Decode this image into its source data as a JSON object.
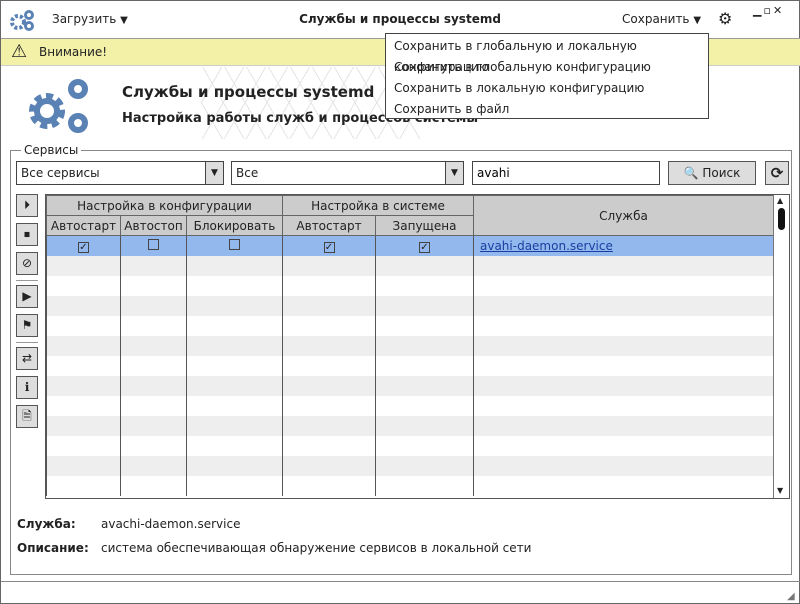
{
  "toolbar": {
    "load_label": "Загрузить",
    "title": "Службы и процессы systemd",
    "save_label": "Сохранить"
  },
  "save_menu": [
    "Сохранить в глобальную и локальную конфигурацию",
    "Сохранить в глобальную конфигурацию",
    "Сохранить в локальную конфигурацию",
    "Сохранить в файл"
  ],
  "warning": "Внимание!",
  "header": {
    "title": "Службы и процессы systemd",
    "subtitle": "Настройка работы служб и процессов системы"
  },
  "services": {
    "group_label": "Сервисы",
    "filter1": "Все сервисы",
    "filter2": "Все",
    "search_value": "avahi",
    "search_label": "Поиск"
  },
  "table": {
    "group_config": "Настройка в конфигурации",
    "group_system": "Настройка в системе",
    "columns": [
      "Автостарт",
      "Автостоп",
      "Блокировать",
      "Автостарт",
      "Запущена",
      "Служба"
    ],
    "rows": [
      {
        "config_autostart": true,
        "config_autostop": false,
        "block": false,
        "sys_autostart": true,
        "running": true,
        "service": "avahi-daemon.service"
      }
    ]
  },
  "details": {
    "service_label": "Служба:",
    "service_value": "avachi-daemon.service",
    "desc_label": "Описание:",
    "desc_value": "система обеспечивающая обнаружение сервисов в локальной сети"
  },
  "colors": {
    "accent": "#5a82b4",
    "selected_row": "#93b8ee",
    "warning_bg": "#f3f0a8"
  }
}
